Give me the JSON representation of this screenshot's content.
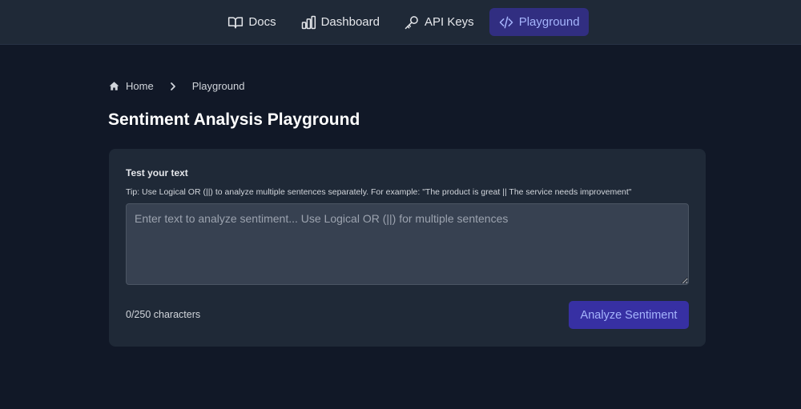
{
  "nav": {
    "items": [
      {
        "label": "Docs",
        "icon": "book-open-icon"
      },
      {
        "label": "Dashboard",
        "icon": "bar-chart-icon"
      },
      {
        "label": "API Keys",
        "icon": "key-icon"
      },
      {
        "label": "Playground",
        "icon": "code-icon",
        "active": true
      }
    ]
  },
  "breadcrumb": {
    "home": "Home",
    "current": "Playground"
  },
  "page": {
    "title": "Sentiment Analysis Playground"
  },
  "card": {
    "label": "Test your text",
    "tip": "Tip: Use Logical OR (||) to analyze multiple sentences separately. For example: \"The product is great || The service needs improvement\"",
    "input_value": "",
    "input_placeholder": "Enter text to analyze sentiment... Use Logical OR (||) for multiple sentences",
    "char_count": "0/250 characters",
    "analyze_label": "Analyze Sentiment"
  },
  "colors": {
    "background": "#111827",
    "surface": "#1f2937",
    "accent": "#3730a3",
    "accent_text": "#a5b4fc"
  }
}
